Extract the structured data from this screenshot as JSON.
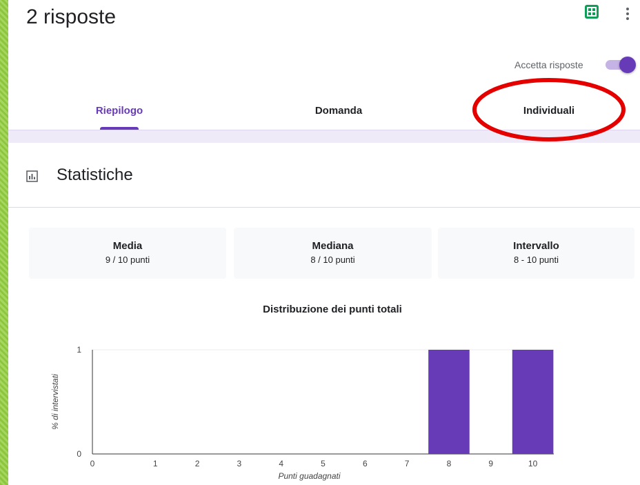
{
  "header": {
    "title": "2 risposte",
    "sheets_icon": "google-sheets-icon",
    "more_icon": "more-vert-icon",
    "accept_label": "Accetta risposte",
    "accept_on": true
  },
  "tabs": [
    {
      "label": "Riepilogo",
      "active": true
    },
    {
      "label": "Domanda",
      "active": false
    },
    {
      "label": "Individuali",
      "active": false
    }
  ],
  "section": {
    "icon": "bar-chart-icon",
    "title": "Statistiche"
  },
  "stats": [
    {
      "label": "Media",
      "value": "9 / 10 punti"
    },
    {
      "label": "Mediana",
      "value": "8 / 10 punti"
    },
    {
      "label": "Intervallo",
      "value": "8 - 10 punti"
    }
  ],
  "chart_data": {
    "type": "bar",
    "title": "Distribuzione dei punti totali",
    "xlabel": "Punti guadagnati",
    "ylabel": "% di intervistati",
    "categories": [
      "0",
      "1",
      "2",
      "3",
      "4",
      "5",
      "6",
      "7",
      "8",
      "9",
      "10"
    ],
    "values": [
      0,
      0,
      0,
      0,
      0,
      0,
      0,
      0,
      1,
      0,
      1
    ],
    "ylim": [
      0,
      1
    ],
    "yticks": [
      "0",
      "1"
    ],
    "bar_color": "#673ab7"
  },
  "colors": {
    "accent": "#673ab7",
    "annotation": "#e50000",
    "background": "#8cc63f"
  }
}
